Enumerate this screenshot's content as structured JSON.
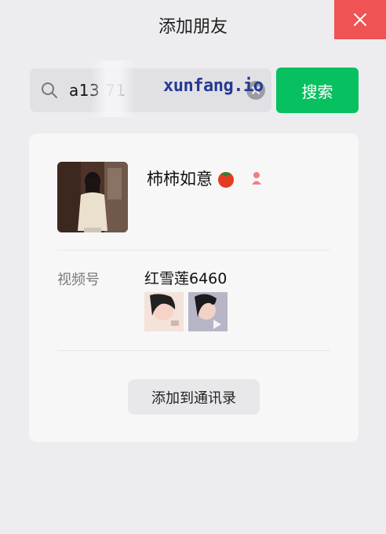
{
  "window": {
    "title": "添加朋友",
    "close_icon": "close-icon"
  },
  "search": {
    "value": "a13        71",
    "watermark": "xunfang.io",
    "button_label": "搜索",
    "search_icon": "search-icon",
    "clear_icon": "clear-icon"
  },
  "profile": {
    "name": "柿柿如意",
    "name_emoji_icon": "tomato-icon",
    "gender_icon": "female-icon"
  },
  "channels": {
    "label": "视频号",
    "name": "红雪莲6460",
    "thumbnails": [
      "thumbnail-1",
      "thumbnail-2"
    ]
  },
  "actions": {
    "add_contact_label": "添加到通讯录"
  },
  "colors": {
    "accent": "#07c160",
    "close": "#ef5353"
  }
}
